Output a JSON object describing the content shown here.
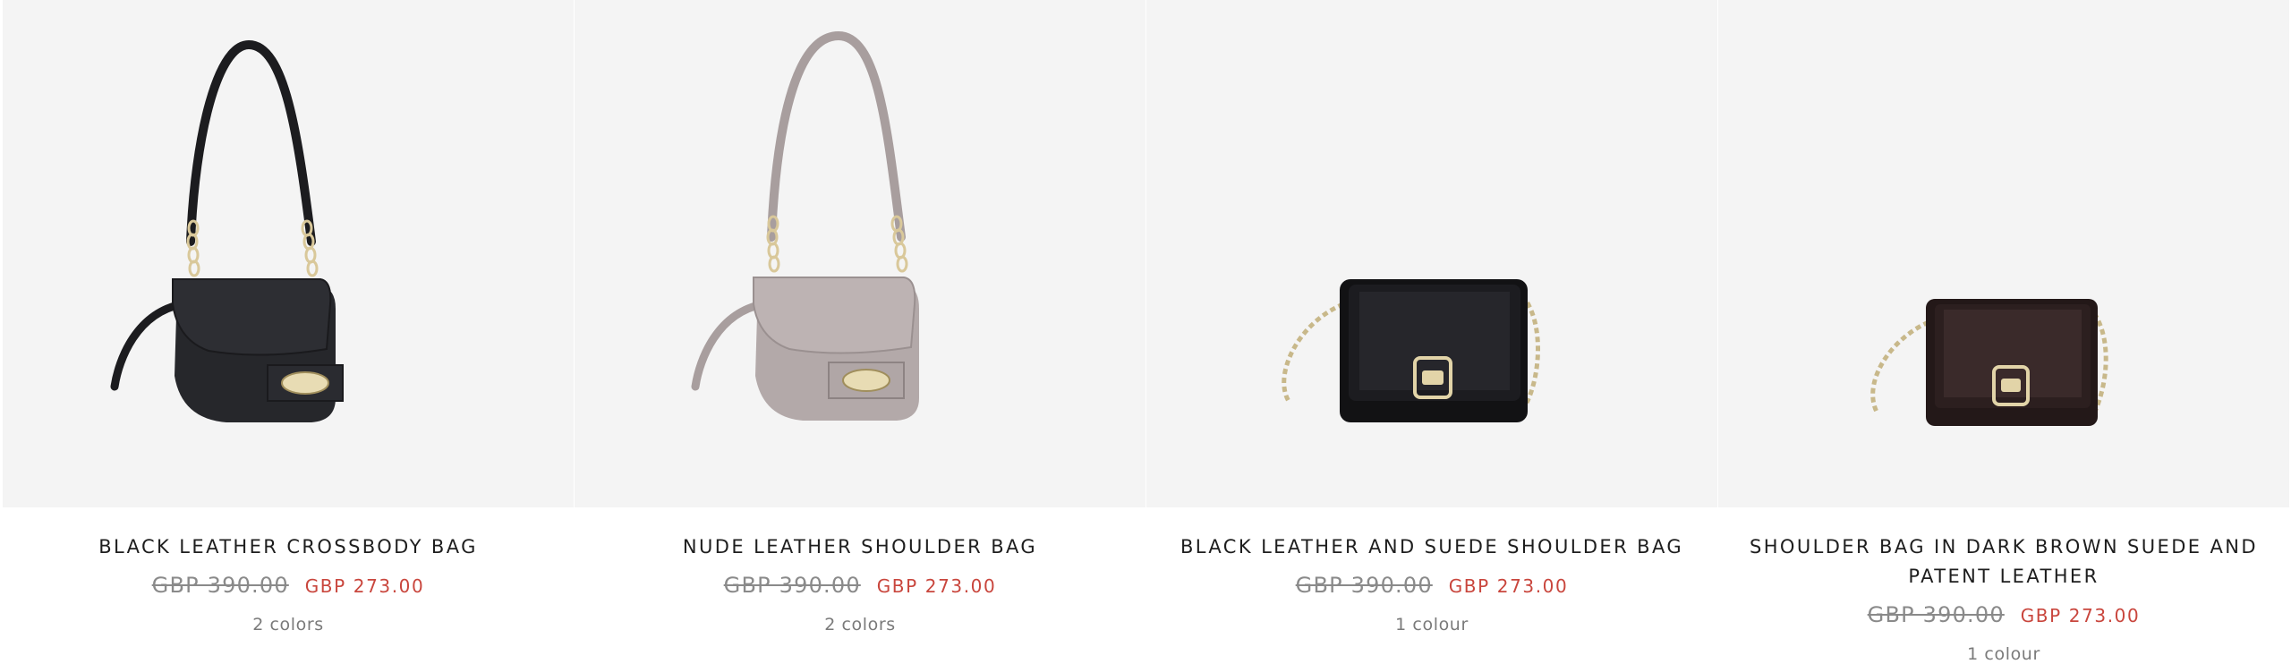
{
  "products": [
    {
      "name": "BLACK LEATHER CROSSBODY BAG",
      "price_old": "GBP 390.00",
      "price_new": "GBP 273.00",
      "colors_label": "2 colors",
      "image_icon": "black-crossbody-bag-photo",
      "bag_color": "#26272b",
      "strap_color": "#1c1c1f"
    },
    {
      "name": "NUDE LEATHER SHOULDER BAG",
      "price_old": "GBP 390.00",
      "price_new": "GBP 273.00",
      "colors_label": "2 colors",
      "image_icon": "nude-shoulder-bag-photo",
      "bag_color": "#b3a9a9",
      "strap_color": "#a89e9e"
    },
    {
      "name": "BLACK LEATHER AND SUEDE SHOULDER BAG",
      "price_old": "GBP 390.00",
      "price_new": "GBP 273.00",
      "colors_label": "1 colour",
      "image_icon": "black-suede-shoulder-bag-photo",
      "bag_color": "#121214",
      "strap_color": "#c8b88a"
    },
    {
      "name": "SHOULDER BAG IN DARK BROWN SUEDE AND PATENT LEATHER",
      "price_old": "GBP 390.00",
      "price_new": "GBP 273.00",
      "colors_label": "1 colour",
      "image_icon": "dark-brown-suede-bag-photo",
      "bag_color": "#2c1f1f",
      "strap_color": "#c8b88a"
    }
  ],
  "colors": {
    "image_background": "#f4f4f4",
    "sale_price": "#c9463d",
    "old_price": "#8a8a8a",
    "title_text": "#1e1e1e",
    "hardware_gold": "#d9c89a"
  }
}
